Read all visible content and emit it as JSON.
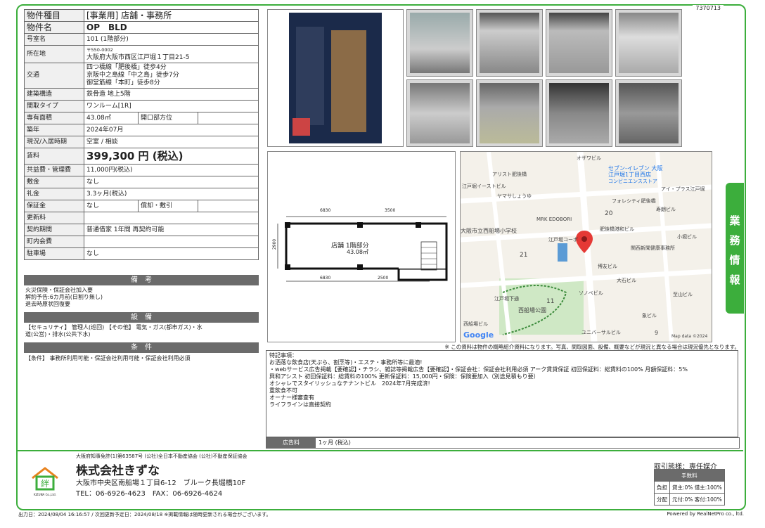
{
  "doc_number": "7370713",
  "property": {
    "type_label": "物件種目",
    "type_value": "[事業用] 店舗・事務所",
    "name_label": "物件名",
    "name_value": "OP　BLD",
    "room_label": "号室名",
    "room_value": "101 (1階部分)",
    "address_label": "所在地",
    "postal": "〒550-0002",
    "address_value": "大阪府大阪市西区江戸堀１丁目21-5",
    "traffic_label": "交通",
    "traffic_lines": [
      "四つ橋線「肥後橋」徒歩4分",
      "京阪中之島線「中之島」徒歩7分",
      "御堂筋線「本町」徒歩8分"
    ],
    "structure_label": "建築構造",
    "structure_value": "鉄骨造 地上5階",
    "layout_label": "間取タイプ",
    "layout_value": "ワンルーム[1R]",
    "area_label": "専有面積",
    "area_value": "43.08㎡",
    "opening_label": "開口部方位",
    "opening_value": "",
    "built_label": "築年",
    "built_value": "2024年07月",
    "status_label": "現況/入居時期",
    "status_value": "空室 / 相談",
    "rent_label": "賃料",
    "rent_value": "399,300 円 (税込)",
    "common_label": "共益費・管理費",
    "common_value": "11,000円(税込)",
    "deposit_label": "敷金",
    "deposit_value": "なし",
    "key_label": "礼金",
    "key_value": "3.3ヶ月(税込)",
    "guarantee_label": "保証金",
    "guarantee_value": "なし",
    "amort_label": "償却・敷引",
    "amort_value": "",
    "renewal_label": "更新料",
    "renewal_value": "",
    "contract_label": "契約期間",
    "contract_value": "普通借家 1年間 再契約可能",
    "town_label": "町内会費",
    "town_value": "",
    "parking_label": "駐車場",
    "parking_value": "なし"
  },
  "sections": {
    "remarks_head": "備　考",
    "remarks_lines": [
      "火災保険・保証会社加入要",
      "解約予告:6カ月前(日割り無し)",
      "退去時原状回復要"
    ],
    "facilities_head": "設　備",
    "facilities_lines": [
      "【セキュリティ】 管理人(巡回) 【その他】 電気・ガス(都市ガス)・水",
      "道(公営)・排水(公共下水)"
    ],
    "conditions_head": "条　件",
    "conditions_lines": [
      "【条件】 事務所利用可能・保証会社利用可能・保証会社利用必須"
    ]
  },
  "floorplan": {
    "room_label": "店舗 1階部分",
    "area": "43.08㎡",
    "dim_top_left": "6830",
    "dim_top_right": "3500",
    "dim_bottom_left": "6830",
    "dim_bottom_right": "2500",
    "dim_side": "2900"
  },
  "map": {
    "labels": [
      "オザワビル",
      "セブン-イレブン 大阪",
      "江戸堀1丁目西店",
      "コンビニエンスストア",
      "アリスト肥後橋",
      "江戸堀イーストビル",
      "ヤマサしょうゆ",
      "アイ・プラス江戸堀",
      "フォレシティ肥後橋",
      "寿朗ビル",
      "20",
      "MRK EDOBORI",
      "大阪市立西船場小学校",
      "肥後橋港和ビル",
      "小堀ビル",
      "江戸堀コーポ",
      "21",
      "関西新聞健康事務所",
      "博友ビル",
      "大石ビル",
      "ソノベビル",
      "11",
      "江戸堀下通",
      "西船場公園",
      "至山ビル",
      "象ビル",
      "西船場ビル",
      "ユニバーサルビル",
      "9",
      "Map data ©2024"
    ],
    "google": "Google"
  },
  "disclaimer": "※ この資料は物件の概略紹介資料になります。写真、間取図面、設備、概要などが現況と異なる場合は現況優先となります。",
  "remarks_box": {
    "title": "特記事項：",
    "lines": [
      "お洒落な飲食店(天ぷら、割烹等)・エステ・事務所等に最適!",
      "・webサービス広告掲載【要確認】・チラシ、雑誌等掲載広告【要確認】・保証会社：保証会社利用必須 アーク賃貸保証 初回保証料：総賃料の100% 月額保証料：5%",
      "興和アシスト 初回保証料：総賃料の100% 更新保証料：15,000円・保険：保険要加入（別途見積もり要）",
      "オシャレでスタイリッシュなテナントビル　2024年7月完成済!",
      "重飲食不可",
      "オーナー様審査有",
      "ライフラインは直接契約"
    ]
  },
  "ad_fee": {
    "label": "広告料",
    "value": "1ヶ月 (税込)"
  },
  "side_tab": [
    "業",
    "務",
    "情",
    "報"
  ],
  "company": {
    "license": "大阪府知事免許(1)第63587号 (公社)全日本不動産協会 (公社)不動産保証協会",
    "name": "株式会社きずな",
    "address": "大阪市中央区南船場１丁目6-12　ブルーク長堀橋10F",
    "tel": "TEL：06-6926-4623　FAX：06-6926-4624",
    "logo_text": "KIZUNA Co.,Ltd."
  },
  "deal": {
    "mode": "取引態様：専任媒介",
    "fee_header": "手数料",
    "row1_label": "負担",
    "row1_value": "貸主:0% 借主:100%",
    "row2_label": "分配",
    "row2_value": "元付:0% 客付:100%"
  },
  "footer": {
    "left": "出力日：2024/08/04 16:16:57 / 次回更新予定日：2024/08/18 ※掲載情報は随時更新される場合がございます。",
    "right": "Powered by RealNetPro co., ltd."
  },
  "colors": {
    "accent": "#3cae3c",
    "header_gray": "#6b6b6b",
    "pin": "#e53935"
  }
}
